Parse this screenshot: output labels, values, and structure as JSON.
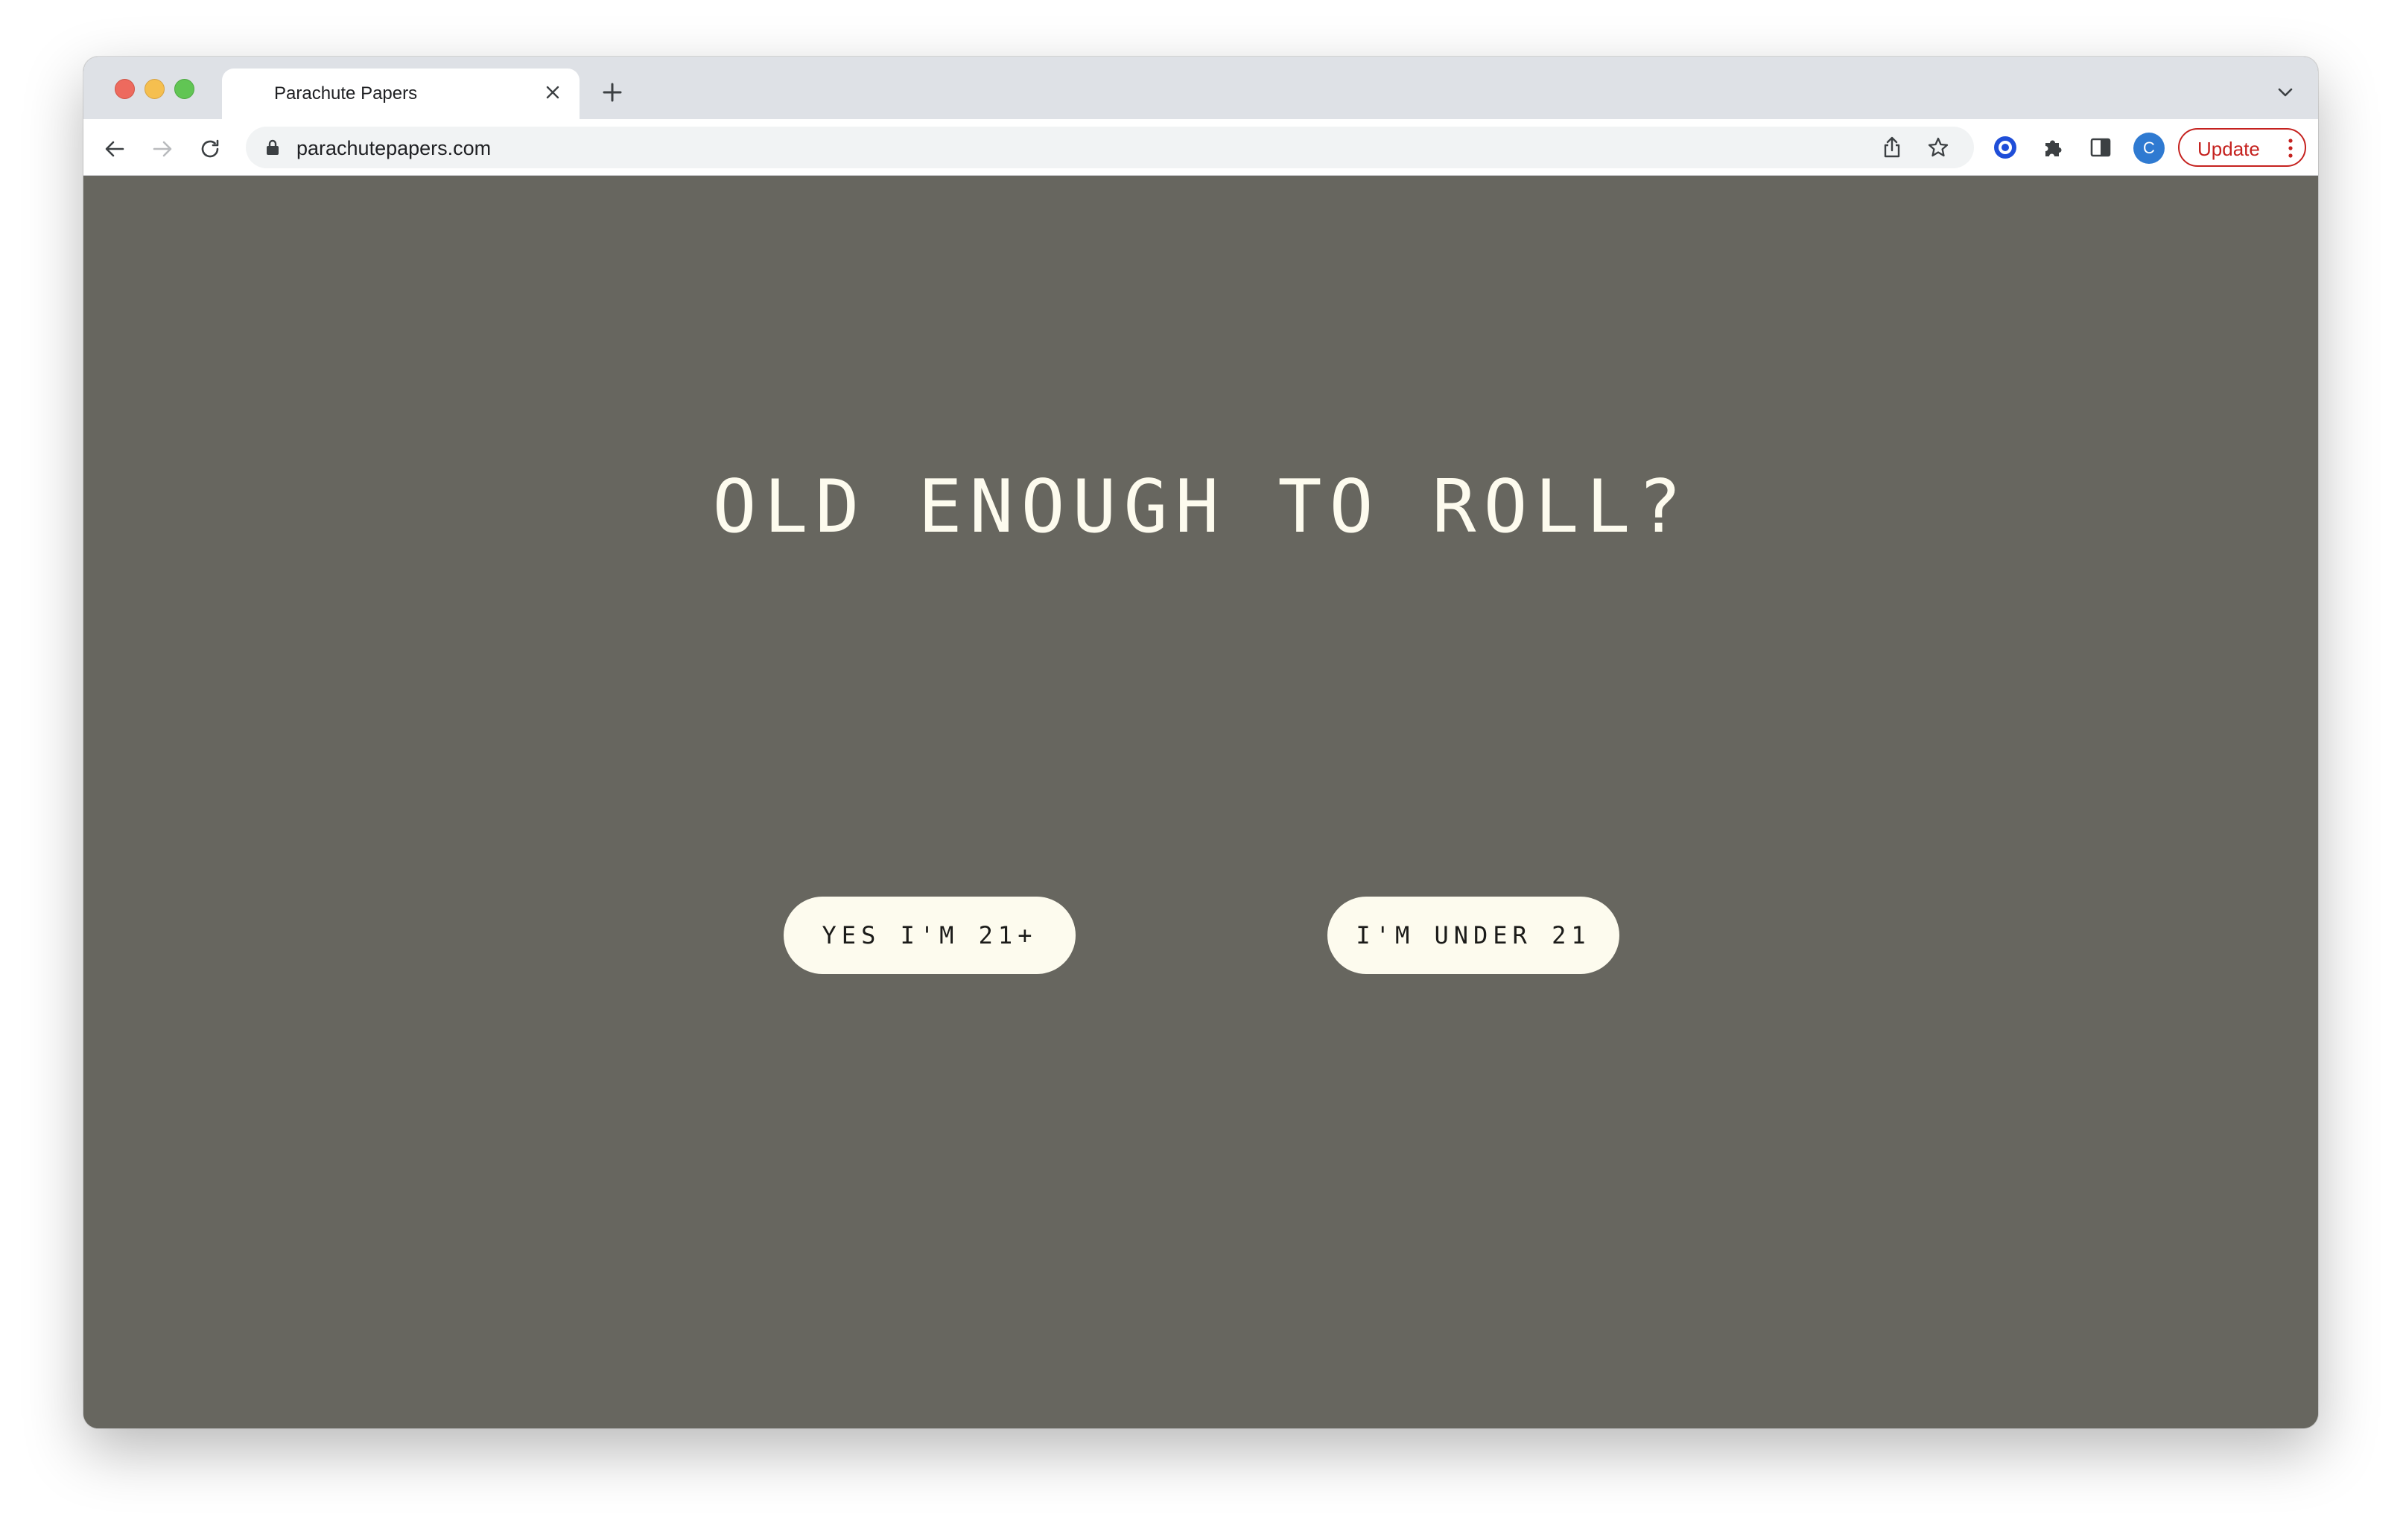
{
  "browser": {
    "tab": {
      "title": "Parachute Papers"
    },
    "address_bar": {
      "url": "parachutepapers.com"
    },
    "profile_initial": "C",
    "update_label": "Update",
    "icons": {
      "close": "close-icon",
      "new_tab": "plus-icon",
      "tab_search": "chevron-down-icon",
      "back": "arrow-left-icon",
      "forward": "arrow-right-icon",
      "reload": "reload-icon",
      "lock": "lock-icon",
      "share": "share-icon",
      "bookmark": "star-icon",
      "extension_target": "target-icon",
      "extensions": "puzzle-icon",
      "side_panel": "side-panel-icon",
      "menu": "kebab-icon"
    }
  },
  "page": {
    "headline": "OLD ENOUGH TO ROLL?",
    "buttons": {
      "yes": "YES I'M 21+",
      "under": "I'M UNDER 21"
    }
  },
  "colors": {
    "page_background": "#67665f",
    "cream": "#fdfbee",
    "update_red": "#c5221f",
    "avatar_blue": "#2f7ad1"
  }
}
